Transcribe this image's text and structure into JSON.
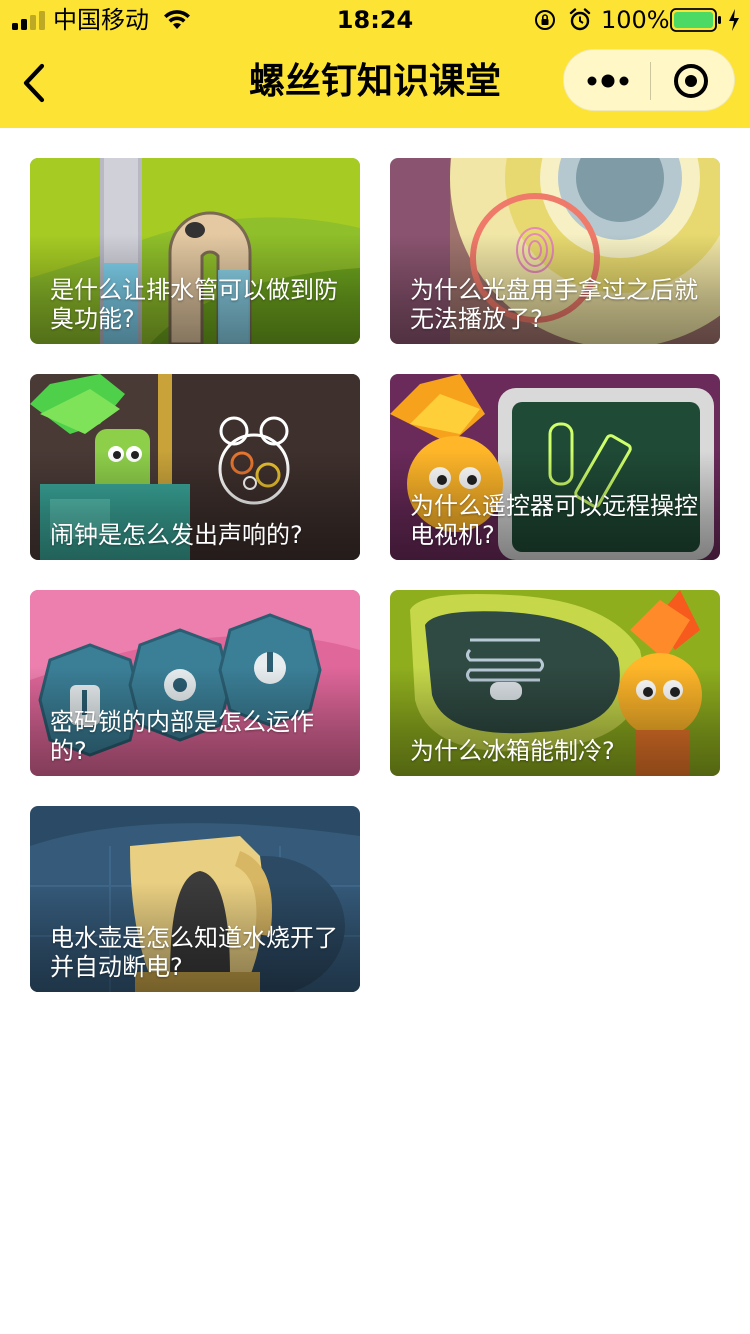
{
  "status_bar": {
    "carrier": "中国移动",
    "time": "18:24",
    "battery_percent": "100%",
    "battery_level": 1.0
  },
  "header": {
    "title": "螺丝钉知识课堂",
    "back_icon": "chevron-left-icon",
    "menu_icon": "more-dots-icon",
    "close_icon": "target-close-icon",
    "background_color": "#FDE334"
  },
  "cards": [
    {
      "title": "是什么让排水管可以做到防臭功能?"
    },
    {
      "title": "为什么光盘用手拿过之后就无法播放了?"
    },
    {
      "title": "闹钟是怎么发出声响的?"
    },
    {
      "title": "为什么遥控器可以远程操控电视机?"
    },
    {
      "title": "密码锁的内部是怎么运作的?"
    },
    {
      "title": "为什么冰箱能制冷?"
    },
    {
      "title": "电水壶是怎么知道水烧开了并自动断电?"
    }
  ]
}
